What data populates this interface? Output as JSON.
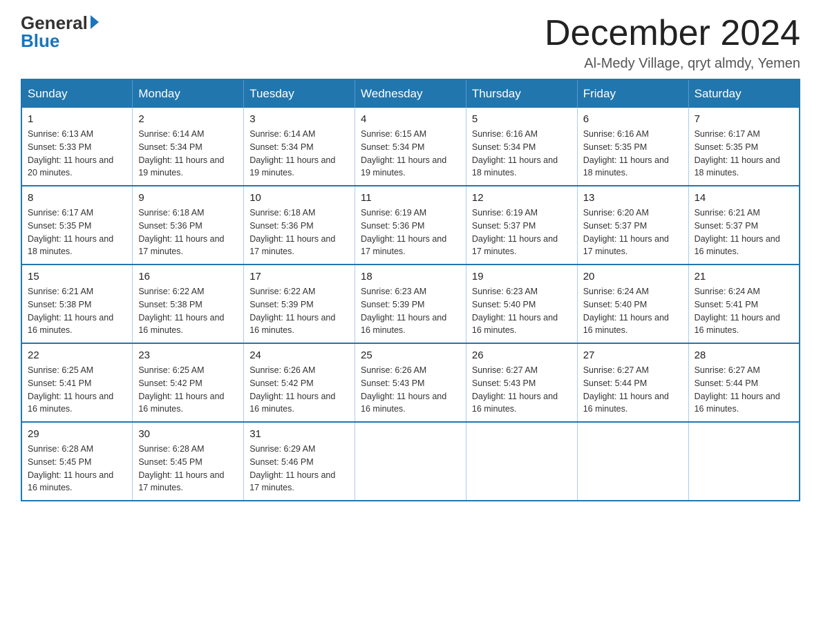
{
  "logo": {
    "general": "General",
    "blue": "Blue"
  },
  "header": {
    "month": "December 2024",
    "location": "Al-Medy Village, qryt almdy, Yemen"
  },
  "days_of_week": [
    "Sunday",
    "Monday",
    "Tuesday",
    "Wednesday",
    "Thursday",
    "Friday",
    "Saturday"
  ],
  "weeks": [
    [
      {
        "day": "1",
        "sunrise": "6:13 AM",
        "sunset": "5:33 PM",
        "daylight": "11 hours and 20 minutes."
      },
      {
        "day": "2",
        "sunrise": "6:14 AM",
        "sunset": "5:34 PM",
        "daylight": "11 hours and 19 minutes."
      },
      {
        "day": "3",
        "sunrise": "6:14 AM",
        "sunset": "5:34 PM",
        "daylight": "11 hours and 19 minutes."
      },
      {
        "day": "4",
        "sunrise": "6:15 AM",
        "sunset": "5:34 PM",
        "daylight": "11 hours and 19 minutes."
      },
      {
        "day": "5",
        "sunrise": "6:16 AM",
        "sunset": "5:34 PM",
        "daylight": "11 hours and 18 minutes."
      },
      {
        "day": "6",
        "sunrise": "6:16 AM",
        "sunset": "5:35 PM",
        "daylight": "11 hours and 18 minutes."
      },
      {
        "day": "7",
        "sunrise": "6:17 AM",
        "sunset": "5:35 PM",
        "daylight": "11 hours and 18 minutes."
      }
    ],
    [
      {
        "day": "8",
        "sunrise": "6:17 AM",
        "sunset": "5:35 PM",
        "daylight": "11 hours and 18 minutes."
      },
      {
        "day": "9",
        "sunrise": "6:18 AM",
        "sunset": "5:36 PM",
        "daylight": "11 hours and 17 minutes."
      },
      {
        "day": "10",
        "sunrise": "6:18 AM",
        "sunset": "5:36 PM",
        "daylight": "11 hours and 17 minutes."
      },
      {
        "day": "11",
        "sunrise": "6:19 AM",
        "sunset": "5:36 PM",
        "daylight": "11 hours and 17 minutes."
      },
      {
        "day": "12",
        "sunrise": "6:19 AM",
        "sunset": "5:37 PM",
        "daylight": "11 hours and 17 minutes."
      },
      {
        "day": "13",
        "sunrise": "6:20 AM",
        "sunset": "5:37 PM",
        "daylight": "11 hours and 17 minutes."
      },
      {
        "day": "14",
        "sunrise": "6:21 AM",
        "sunset": "5:37 PM",
        "daylight": "11 hours and 16 minutes."
      }
    ],
    [
      {
        "day": "15",
        "sunrise": "6:21 AM",
        "sunset": "5:38 PM",
        "daylight": "11 hours and 16 minutes."
      },
      {
        "day": "16",
        "sunrise": "6:22 AM",
        "sunset": "5:38 PM",
        "daylight": "11 hours and 16 minutes."
      },
      {
        "day": "17",
        "sunrise": "6:22 AM",
        "sunset": "5:39 PM",
        "daylight": "11 hours and 16 minutes."
      },
      {
        "day": "18",
        "sunrise": "6:23 AM",
        "sunset": "5:39 PM",
        "daylight": "11 hours and 16 minutes."
      },
      {
        "day": "19",
        "sunrise": "6:23 AM",
        "sunset": "5:40 PM",
        "daylight": "11 hours and 16 minutes."
      },
      {
        "day": "20",
        "sunrise": "6:24 AM",
        "sunset": "5:40 PM",
        "daylight": "11 hours and 16 minutes."
      },
      {
        "day": "21",
        "sunrise": "6:24 AM",
        "sunset": "5:41 PM",
        "daylight": "11 hours and 16 minutes."
      }
    ],
    [
      {
        "day": "22",
        "sunrise": "6:25 AM",
        "sunset": "5:41 PM",
        "daylight": "11 hours and 16 minutes."
      },
      {
        "day": "23",
        "sunrise": "6:25 AM",
        "sunset": "5:42 PM",
        "daylight": "11 hours and 16 minutes."
      },
      {
        "day": "24",
        "sunrise": "6:26 AM",
        "sunset": "5:42 PM",
        "daylight": "11 hours and 16 minutes."
      },
      {
        "day": "25",
        "sunrise": "6:26 AM",
        "sunset": "5:43 PM",
        "daylight": "11 hours and 16 minutes."
      },
      {
        "day": "26",
        "sunrise": "6:27 AM",
        "sunset": "5:43 PM",
        "daylight": "11 hours and 16 minutes."
      },
      {
        "day": "27",
        "sunrise": "6:27 AM",
        "sunset": "5:44 PM",
        "daylight": "11 hours and 16 minutes."
      },
      {
        "day": "28",
        "sunrise": "6:27 AM",
        "sunset": "5:44 PM",
        "daylight": "11 hours and 16 minutes."
      }
    ],
    [
      {
        "day": "29",
        "sunrise": "6:28 AM",
        "sunset": "5:45 PM",
        "daylight": "11 hours and 16 minutes."
      },
      {
        "day": "30",
        "sunrise": "6:28 AM",
        "sunset": "5:45 PM",
        "daylight": "11 hours and 17 minutes."
      },
      {
        "day": "31",
        "sunrise": "6:29 AM",
        "sunset": "5:46 PM",
        "daylight": "11 hours and 17 minutes."
      },
      null,
      null,
      null,
      null
    ]
  ]
}
